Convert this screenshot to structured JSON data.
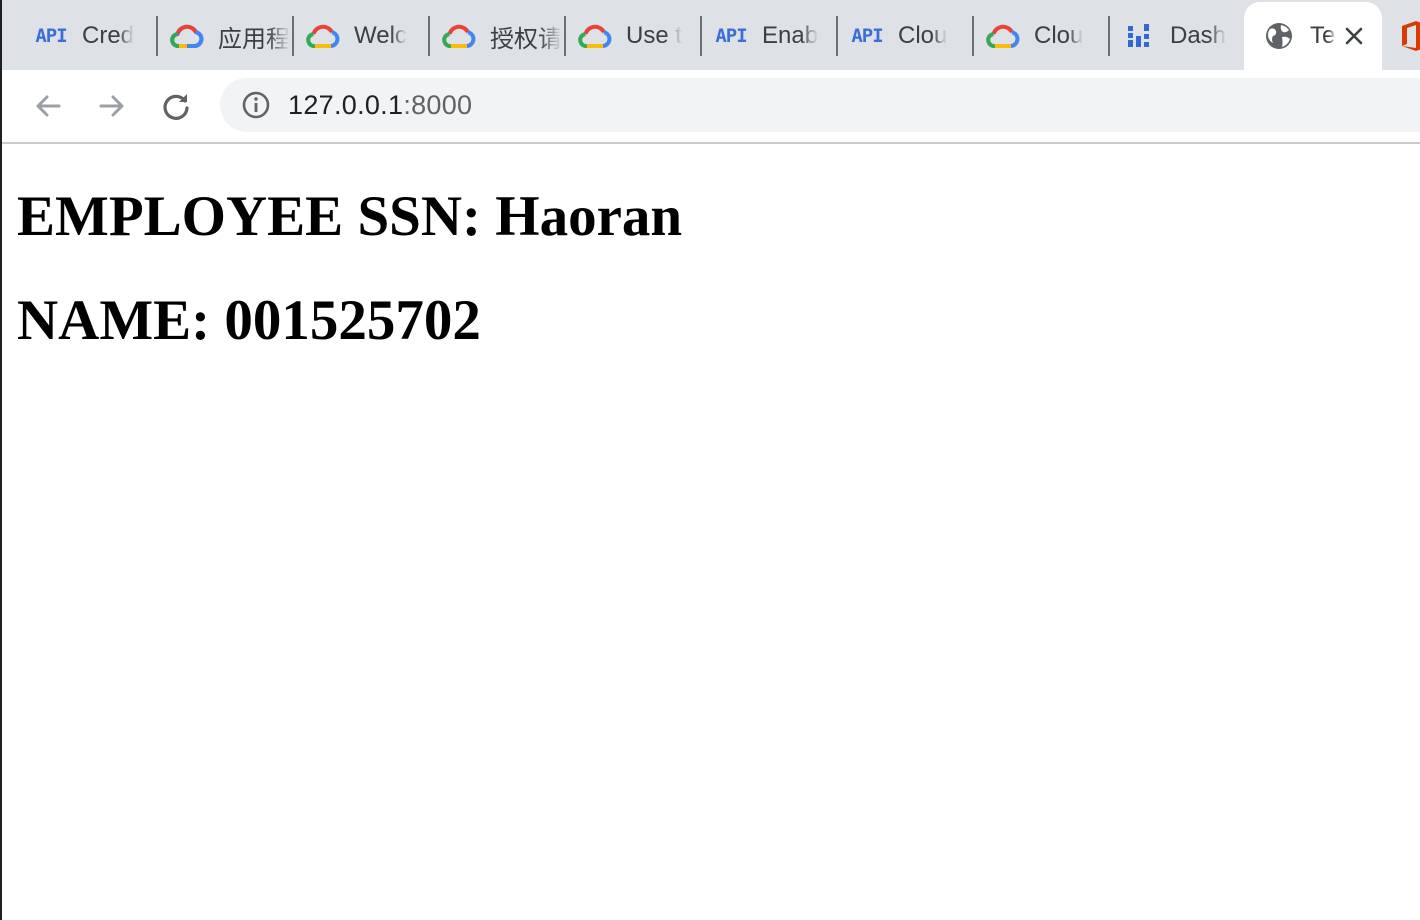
{
  "browser": {
    "tabs": [
      {
        "title": "Cred",
        "icon": "api-icon"
      },
      {
        "title": "应用程",
        "icon": "google-cloud-icon"
      },
      {
        "title": "Welc",
        "icon": "google-cloud-icon"
      },
      {
        "title": "授权请",
        "icon": "google-cloud-icon"
      },
      {
        "title": "Use t",
        "icon": "google-cloud-icon"
      },
      {
        "title": "Enab",
        "icon": "api-icon"
      },
      {
        "title": "Clou",
        "icon": "api-icon"
      },
      {
        "title": "Clou",
        "icon": "google-cloud-icon"
      },
      {
        "title": "Dash",
        "icon": "dashboard-icon"
      },
      {
        "title": "Te",
        "icon": "globe-icon",
        "active": true
      }
    ],
    "api_icon_text": "API",
    "address_bar": {
      "host": "127.0.0.1",
      "port": ":8000"
    }
  },
  "page": {
    "line1": "EMPLOYEE SSN: Haoran",
    "line2": "NAME: 001525702"
  }
}
